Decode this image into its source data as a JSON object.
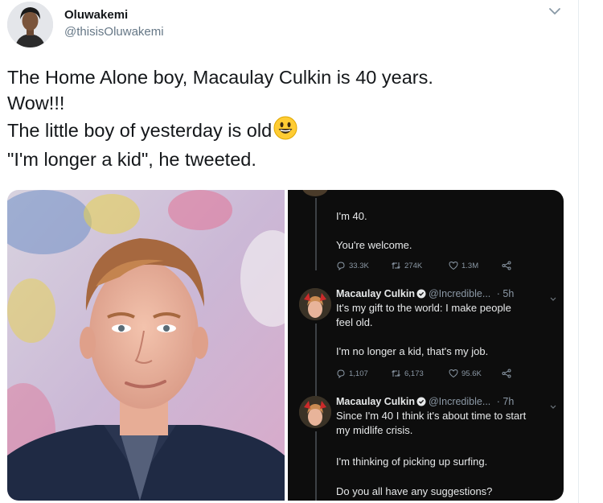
{
  "user": {
    "name": "Oluwakemi",
    "handle": "@thisisOluwakemi"
  },
  "tweet": {
    "lines": [
      "The Home Alone boy, Macaulay Culkin is 40 years.",
      "Wow!!!",
      "The little boy of yesterday is old",
      "\"I'm longer a kid\", he tweeted."
    ],
    "emoji": "grinning-face-emoji"
  },
  "screenshot": {
    "tweet1": {
      "line1": "I'm 40.",
      "line2": "You're welcome.",
      "replies": "33.3K",
      "retweets": "274K",
      "likes": "1.3M"
    },
    "tweet2": {
      "name": "Macaulay Culkin",
      "handle": "@Incredible...",
      "time": "· 5h",
      "text1": "It's my gift to the world: I make people",
      "text2": "feel old.",
      "text3": "I'm no longer a kid, that's my job.",
      "replies": "1,107",
      "retweets": "6,173",
      "likes": "95.6K"
    },
    "tweet3": {
      "name": "Macaulay Culkin",
      "handle": "@Incredible...",
      "time": "· 7h",
      "text1": "Since I'm 40 I think it's about time to start",
      "text2": "my midlife crisis.",
      "text3": "I'm thinking of picking up surfing.",
      "text4": "Do you all have any suggestions?"
    }
  },
  "colors": {
    "accent": "#1da1f2",
    "text": "#14171a",
    "muted": "#657786",
    "dark_bg": "#0d0d0d"
  }
}
